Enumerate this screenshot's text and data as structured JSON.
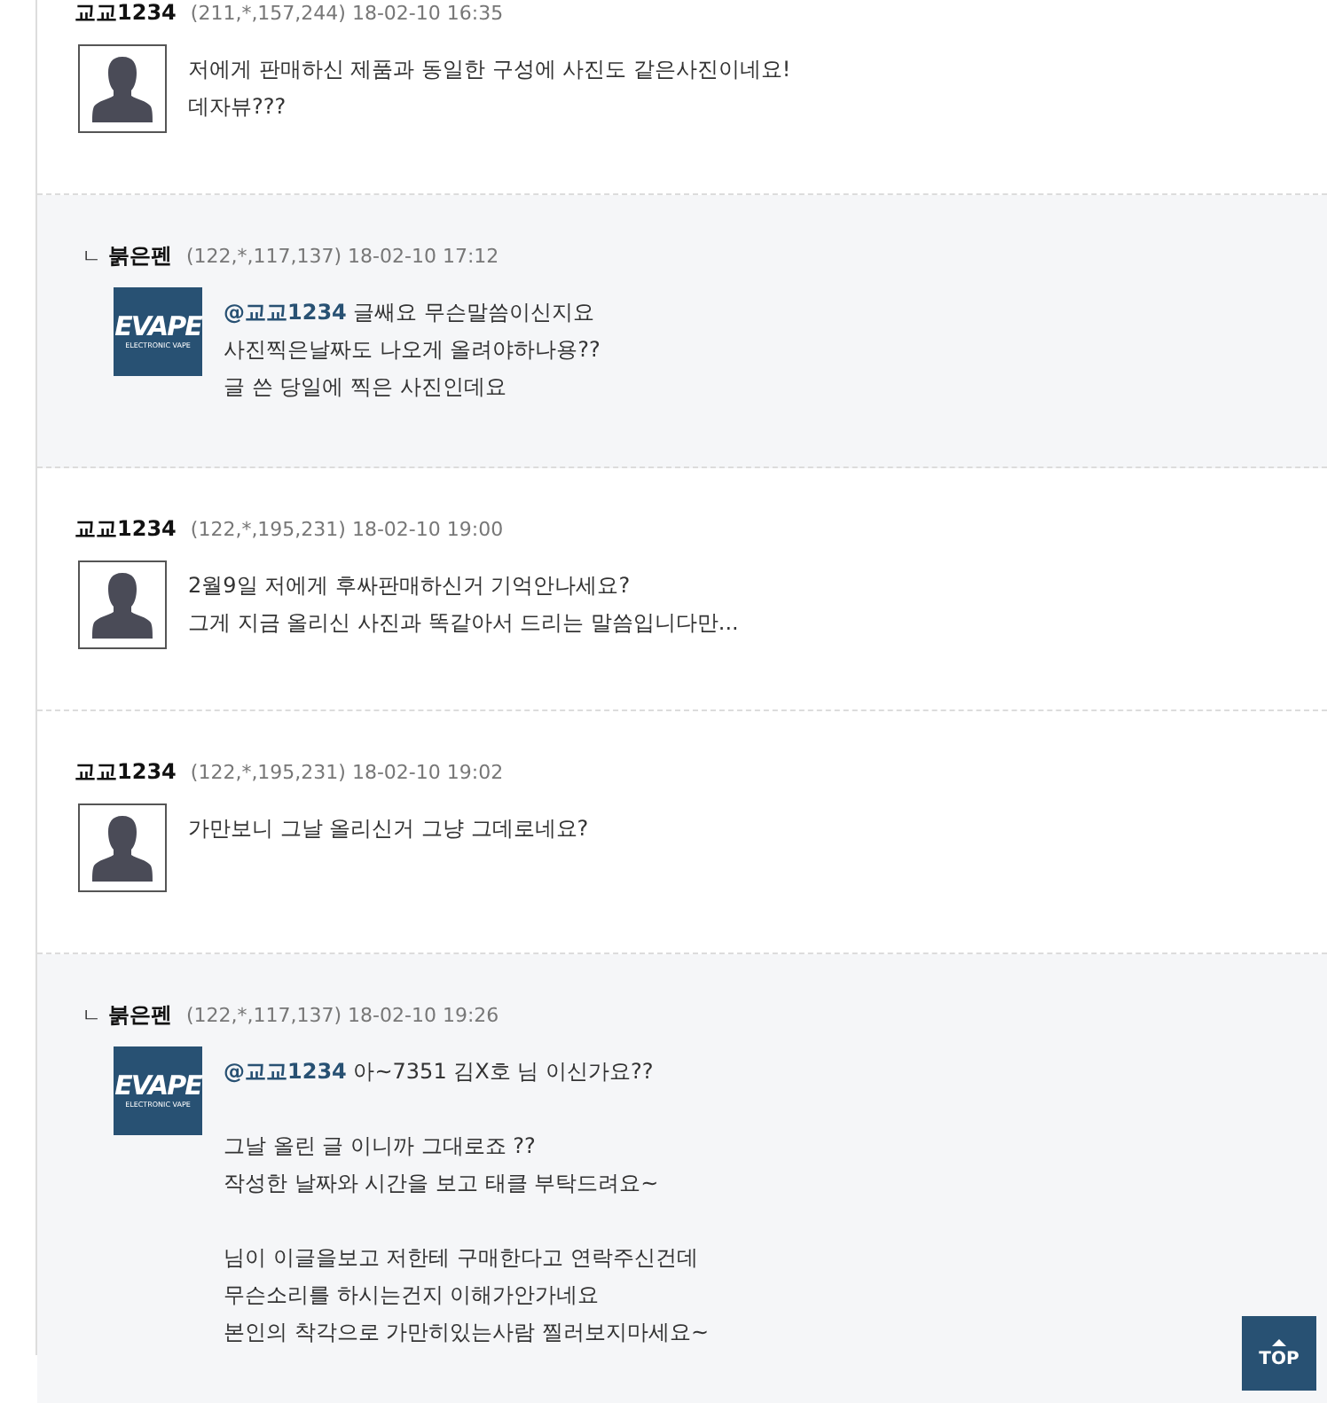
{
  "comments": [
    {
      "kind": "comment",
      "author": "교교1234",
      "meta": "(211,*,157,244) 18-02-10 16:35",
      "avatar": {
        "kind": "silhouette"
      },
      "paragraphs": [
        [
          "저에게 판매하신 제품과 동일한 구성에 사진도 같은사진이네요!",
          "데자뷰???"
        ]
      ]
    },
    {
      "kind": "reply",
      "reply_mark": "ㄴ",
      "author": "붉은펜",
      "meta": "(122,*,117,137) 18-02-10 17:12",
      "avatar": {
        "kind": "logo",
        "title": "EVAPE",
        "subtitle": "ELECTRONIC VAPE"
      },
      "mention": "@교교1234",
      "paragraphs": [
        [
          "글쌔요 무슨말씀이신지요",
          "사진찍은날짜도 나오게 올려야하나용??",
          "글 쓴 당일에 찍은 사진인데요"
        ]
      ]
    },
    {
      "kind": "comment",
      "author": "교교1234",
      "meta": "(122,*,195,231) 18-02-10 19:00",
      "avatar": {
        "kind": "silhouette"
      },
      "paragraphs": [
        [
          "2월9일 저에게 후싸판매하신거 기억안나세요?",
          "그게 지금 올리신 사진과 똑같아서 드리는 말씀입니다만..."
        ]
      ]
    },
    {
      "kind": "comment",
      "author": "교교1234",
      "meta": "(122,*,195,231) 18-02-10 19:02",
      "avatar": {
        "kind": "silhouette"
      },
      "paragraphs": [
        [
          "가만보니 그날 올리신거 그냥 그데로네요?"
        ]
      ]
    },
    {
      "kind": "reply",
      "reply_mark": "ㄴ",
      "author": "붉은펜",
      "meta": "(122,*,117,137) 18-02-10 19:26",
      "avatar": {
        "kind": "logo",
        "title": "EVAPE",
        "subtitle": "ELECTRONIC VAPE"
      },
      "mention": "@교교1234",
      "paragraphs": [
        [
          "아~7351 김X호 님 이신가요??"
        ],
        [
          "그날 올린 글 이니까 그대로죠 ??",
          "작성한 날짜와 시간을 보고 태클 부탁드려요~"
        ],
        [
          "님이 이글을보고 저한테 구매한다고 연락주신건데",
          "무슨소리를 하시는건지 이해가안가네요",
          "본인의 착각으로 가만히있는사람 찔러보지마세요~"
        ]
      ]
    }
  ],
  "top_button": {
    "label": "TOP"
  }
}
